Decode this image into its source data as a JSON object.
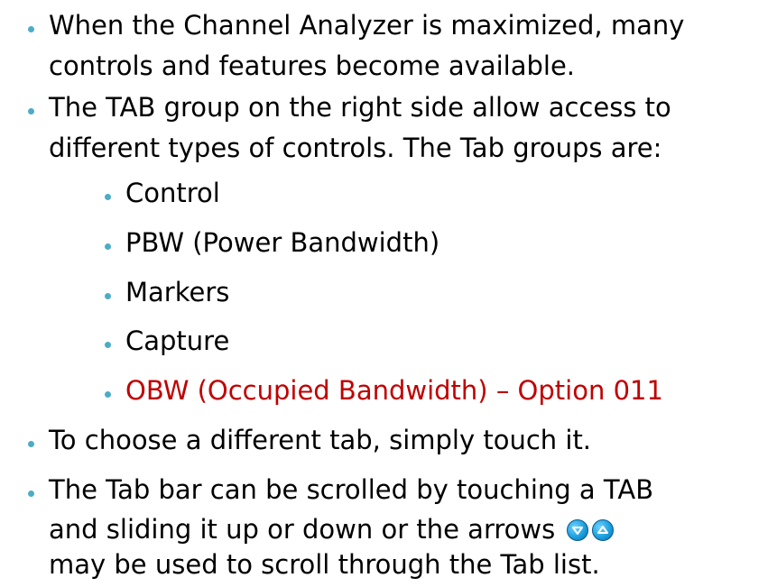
{
  "bullet_color": "#4bacc6",
  "bullets": [
    {
      "lines": [
        "When the Channel Analyzer is maximized, many",
        "controls and features become available."
      ]
    },
    {
      "lines": [
        "The TAB group on the right side allow access to",
        "different types of controls. The Tab groups are:"
      ]
    },
    {
      "lines": [
        "To choose a different tab, simply touch it."
      ]
    },
    {
      "lines": [
        "The Tab bar can be scrolled by touching a TAB",
        "and sliding it up or down or the arrows",
        "may be used to scroll through the Tab list."
      ]
    }
  ],
  "sub_bullets": [
    {
      "label": "Control"
    },
    {
      "label": "PBW (Power Bandwidth)"
    },
    {
      "label": "Markers"
    },
    {
      "label": "Capture"
    },
    {
      "label": "OBW (Occupied Bandwidth) – Option 011",
      "color": "#c00000"
    }
  ],
  "icons": {
    "scroll_down": "arrow-down-circle-icon",
    "scroll_up": "arrow-up-circle-icon"
  }
}
